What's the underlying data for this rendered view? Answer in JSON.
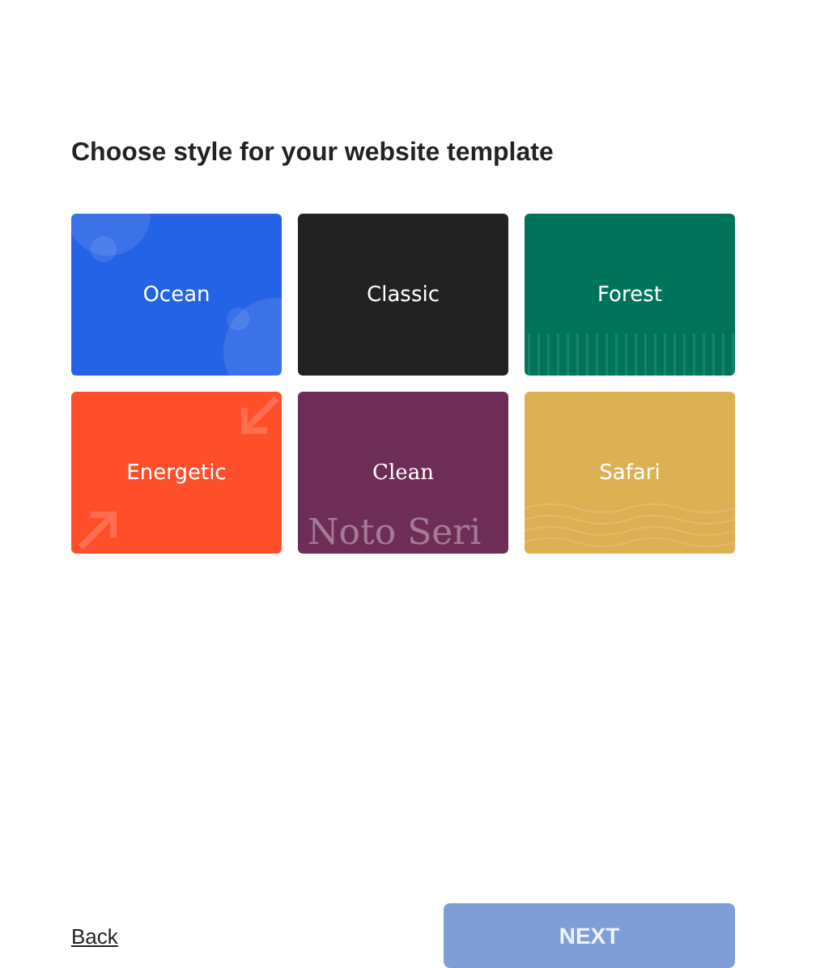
{
  "heading": "Choose style for your website template",
  "styles": [
    {
      "label": "Ocean",
      "color": "#2563e6",
      "kind": "bubbles"
    },
    {
      "label": "Classic",
      "color": "#222222",
      "kind": "plain"
    },
    {
      "label": "Forest",
      "color": "#00745a",
      "kind": "stripes"
    },
    {
      "label": "Energetic",
      "color": "#ff4f2a",
      "kind": "arrows"
    },
    {
      "label": "Clean",
      "color": "#6e2d57",
      "kind": "serif",
      "decor_text": "Noto Seri"
    },
    {
      "label": "Safari",
      "color": "#deb054",
      "kind": "waves"
    }
  ],
  "back": {
    "label": "Back"
  },
  "next": {
    "label": "NEXT",
    "disabled": true
  }
}
